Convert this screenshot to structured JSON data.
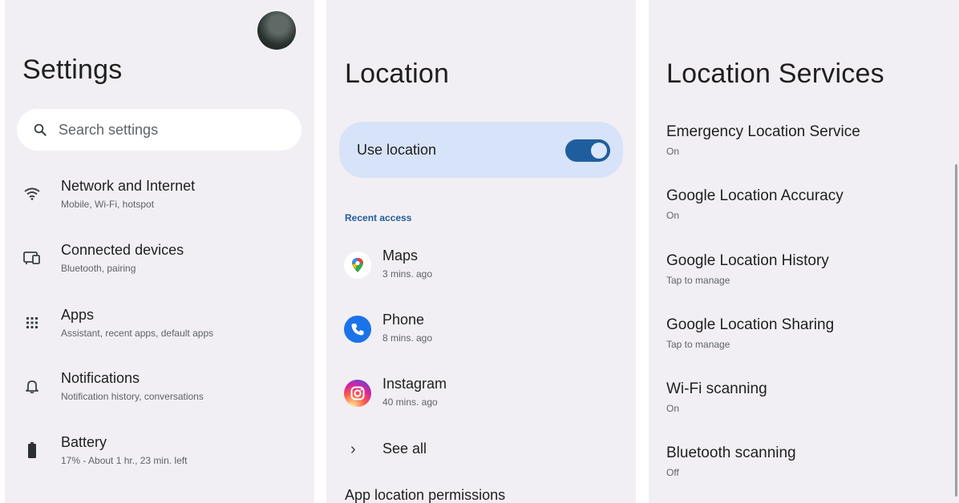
{
  "settings": {
    "title": "Settings",
    "search_placeholder": "Search settings",
    "items": [
      {
        "title": "Network and Internet",
        "subtitle": "Mobile, Wi-Fi, hotspot",
        "icon": "wifi-icon"
      },
      {
        "title": "Connected devices",
        "subtitle": "Bluetooth, pairing",
        "icon": "connected-devices-icon"
      },
      {
        "title": "Apps",
        "subtitle": "Assistant, recent apps, default apps",
        "icon": "apps-grid-icon"
      },
      {
        "title": "Notifications",
        "subtitle": "Notification history, conversations",
        "icon": "bell-icon"
      },
      {
        "title": "Battery",
        "subtitle": "17% - About 1 hr., 23 min. left",
        "icon": "battery-icon"
      }
    ]
  },
  "location": {
    "title": "Location",
    "use_location_label": "Use location",
    "use_location_on": true,
    "recent_access_label": "Recent access",
    "apps": [
      {
        "name": "Maps",
        "time": "3 mins. ago",
        "icon": "maps-icon"
      },
      {
        "name": "Phone",
        "time": "8 mins. ago",
        "icon": "phone-icon"
      },
      {
        "name": "Instagram",
        "time": "40 mins. ago",
        "icon": "instagram-icon"
      }
    ],
    "see_all_label": "See all",
    "app_permissions_label": "App location permissions"
  },
  "location_services": {
    "title": "Location Services",
    "items": [
      {
        "title": "Emergency Location Service",
        "subtitle": "On"
      },
      {
        "title": "Google Location Accuracy",
        "subtitle": "On"
      },
      {
        "title": "Google Location History",
        "subtitle": "Tap to manage"
      },
      {
        "title": "Google Location Sharing",
        "subtitle": "Tap to manage"
      },
      {
        "title": "Wi-Fi scanning",
        "subtitle": "On"
      },
      {
        "title": "Bluetooth scanning",
        "subtitle": "Off"
      }
    ]
  },
  "colors": {
    "background": "#f1eff4",
    "accent": "#1f5e9e",
    "use_location_bg": "#d7e3f8"
  }
}
